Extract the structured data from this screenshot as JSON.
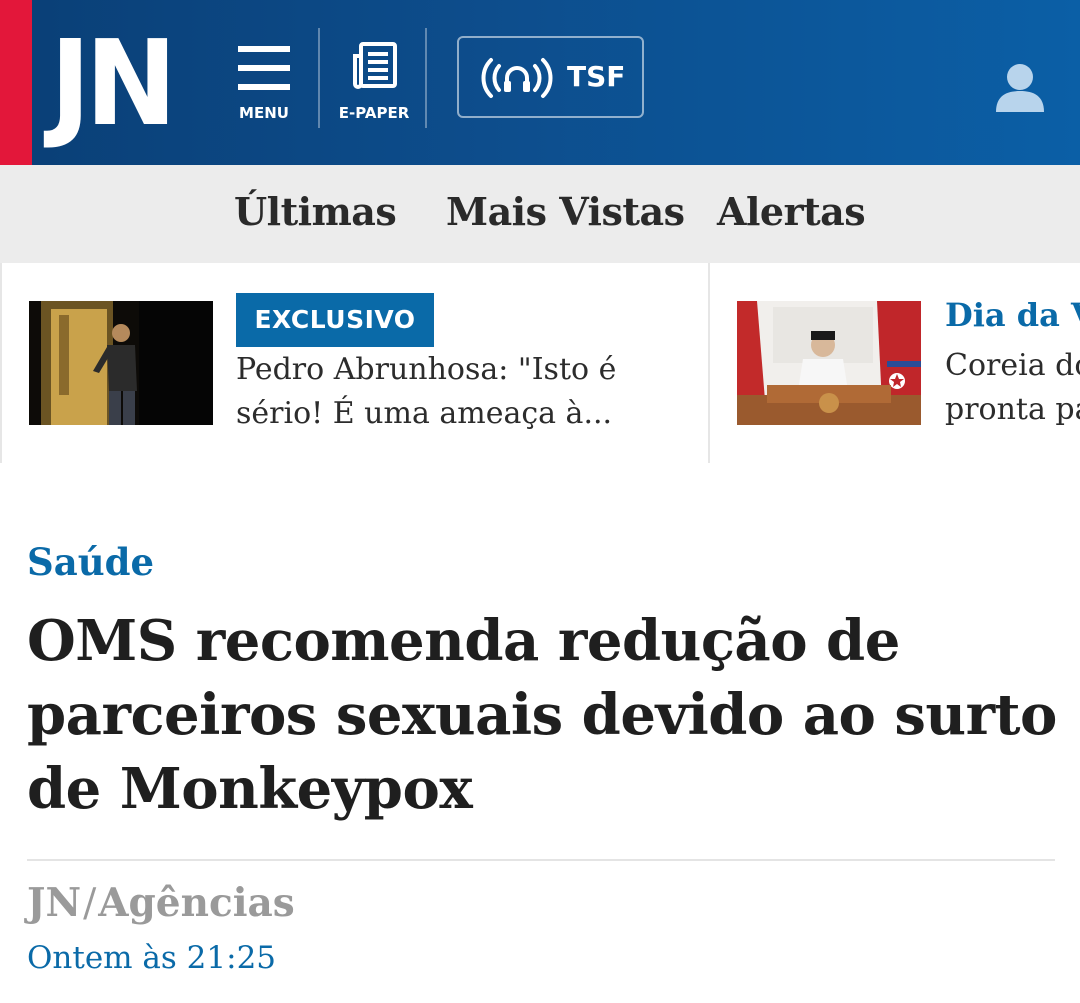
{
  "header": {
    "logo": "JN",
    "menu_label": "MENU",
    "epaper_label": "E-PAPER",
    "tsf_label": "TSF",
    "icons": {
      "menu": "hamburger-icon",
      "epaper": "newspaper-icon",
      "tsf": "radio-headphones-icon",
      "user": "user-icon"
    },
    "colors": {
      "brand_blue": "#0a4a86",
      "accent_red": "#e3173a"
    }
  },
  "subnav": {
    "items": [
      {
        "label": "Últimas"
      },
      {
        "label": "Mais Vistas"
      },
      {
        "label": "Alertas"
      }
    ]
  },
  "teasers": [
    {
      "badge": "EXCLUSIVO",
      "lines": [
        "Pedro Abrunhosa: \"Isto é",
        "sério! É uma ameaça à..."
      ]
    },
    {
      "category": "Dia da V",
      "lines": [
        "Coreia do",
        "pronta pa"
      ]
    }
  ],
  "article": {
    "category": "Saúde",
    "headline_lines": [
      "OMS recomenda redução de",
      "parceiros sexuais devido ao surto",
      "de Monkeypox"
    ],
    "author_org": "JN",
    "author_sep": "/",
    "author_source": "Agências",
    "timestamp": "Ontem às 21:25",
    "accent_color": "#0a6aa8"
  }
}
